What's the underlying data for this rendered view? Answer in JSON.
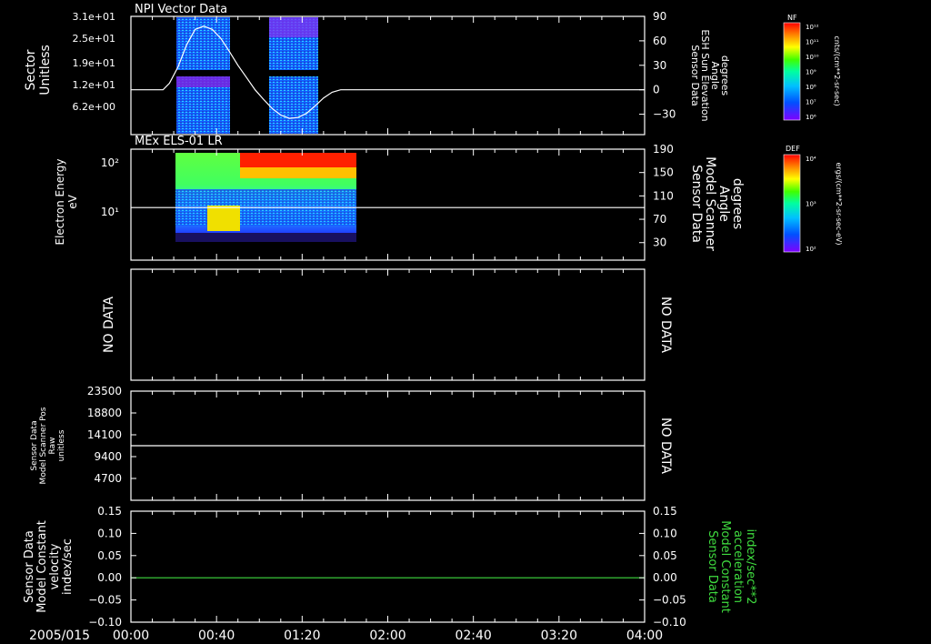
{
  "date_label": "2005/015",
  "time_ticks": [
    "00:00",
    "00:40",
    "01:20",
    "02:00",
    "02:40",
    "03:20",
    "04:00"
  ],
  "colors": {
    "background": "#000000",
    "axis": "#ffffff",
    "green_series": "#3fdc3f"
  },
  "chart_data": [
    {
      "type": "heatmap",
      "title": "NPI Vector Data",
      "ylabel": "Sector\nUnitless",
      "yticks": [
        "3.1e+01",
        "2.5e+01",
        "1.9e+01",
        "1.2e+01",
        "6.2e+00"
      ],
      "y2label": "Sensor Data\nESH Sun Elevation\nAngle\ndegrees",
      "y2ticks": [
        "90",
        "60",
        "30",
        "0",
        "−30"
      ],
      "y2lim": [
        -55,
        90
      ],
      "colorbar": {
        "label": "NF",
        "units": "cnts/(cm**2-sr-sec)",
        "ticks": [
          "10¹²",
          "10¹¹",
          "10¹⁰",
          "10⁹",
          "10⁸",
          "10⁷",
          "10⁶"
        ]
      },
      "data_blocks": [
        {
          "x": [
            "00:27",
            "00:47"
          ]
        },
        {
          "x": [
            "01:06",
            "01:24"
          ]
        }
      ],
      "overlay_line": {
        "name": "ESH Sun Elevation Angle",
        "x": [
          "00:00",
          "00:15",
          "00:18",
          "00:22",
          "00:26",
          "00:30",
          "00:34",
          "00:38",
          "00:42",
          "00:46",
          "00:50",
          "00:54",
          "00:58",
          "01:02",
          "01:06",
          "01:10",
          "01:14",
          "01:18",
          "01:22",
          "01:26",
          "01:30",
          "01:34",
          "01:38",
          "01:42",
          "04:00"
        ],
        "y": [
          0,
          0,
          8,
          28,
          55,
          74,
          78,
          74,
          63,
          47,
          30,
          15,
          0,
          -12,
          -23,
          -31,
          -35,
          -34,
          -29,
          -20,
          -10,
          -3,
          0,
          0,
          0
        ]
      }
    },
    {
      "type": "heatmap",
      "title": "MEx ELS-01 LR",
      "ylabel": "Electron Energy\neV",
      "yticks": [
        "10²",
        "10¹"
      ],
      "y2label": "Sensor Data\nModel Scanner\nAngle\ndegrees",
      "y2ticks": [
        "190",
        "150",
        "110",
        "70",
        "30"
      ],
      "y2lim": [
        0,
        190
      ],
      "colorbar": {
        "label": "DEF",
        "units": "ergs/(cm**2-sr-sec-eV)",
        "ticks": [
          "10⁴",
          "10³",
          "10²"
        ]
      },
      "data_x_range": [
        "00:27",
        "01:46"
      ],
      "overlay_line": {
        "name": "Model Scanner Angle",
        "y": 90
      }
    },
    {
      "type": "line",
      "status_left": "NO DATA",
      "status_right": "NO DATA"
    },
    {
      "type": "line",
      "ylabel": "Sensor Data\nModel Scanner Pos\nRaw\nunitless",
      "yticks": [
        "23500",
        "18800",
        "14100",
        "9400",
        "4700"
      ],
      "ylim": [
        0,
        23500
      ],
      "status_right": "NO DATA",
      "series": [
        {
          "x": [
            "00:00",
            "04:00"
          ],
          "y": [
            11750,
            11750
          ]
        }
      ]
    },
    {
      "type": "line",
      "ylabel": "Sensor Data\nModel Constant\nvelocity\nindex/sec",
      "yticks": [
        "0.15",
        "0.10",
        "0.05",
        "0.00",
        "−0.05",
        "−0.10"
      ],
      "ylim": [
        -0.1,
        0.15
      ],
      "y2label": "Sensor Data\nModel Constant\nacceleration\nindex/sec**2",
      "y2ticks": [
        "0.15",
        "0.10",
        "0.05",
        "0.00",
        "−0.05",
        "−0.10"
      ],
      "y2lim": [
        -0.1,
        0.15
      ],
      "series": [
        {
          "x": [
            "00:00",
            "04:00"
          ],
          "y": [
            0,
            0
          ]
        }
      ]
    }
  ]
}
